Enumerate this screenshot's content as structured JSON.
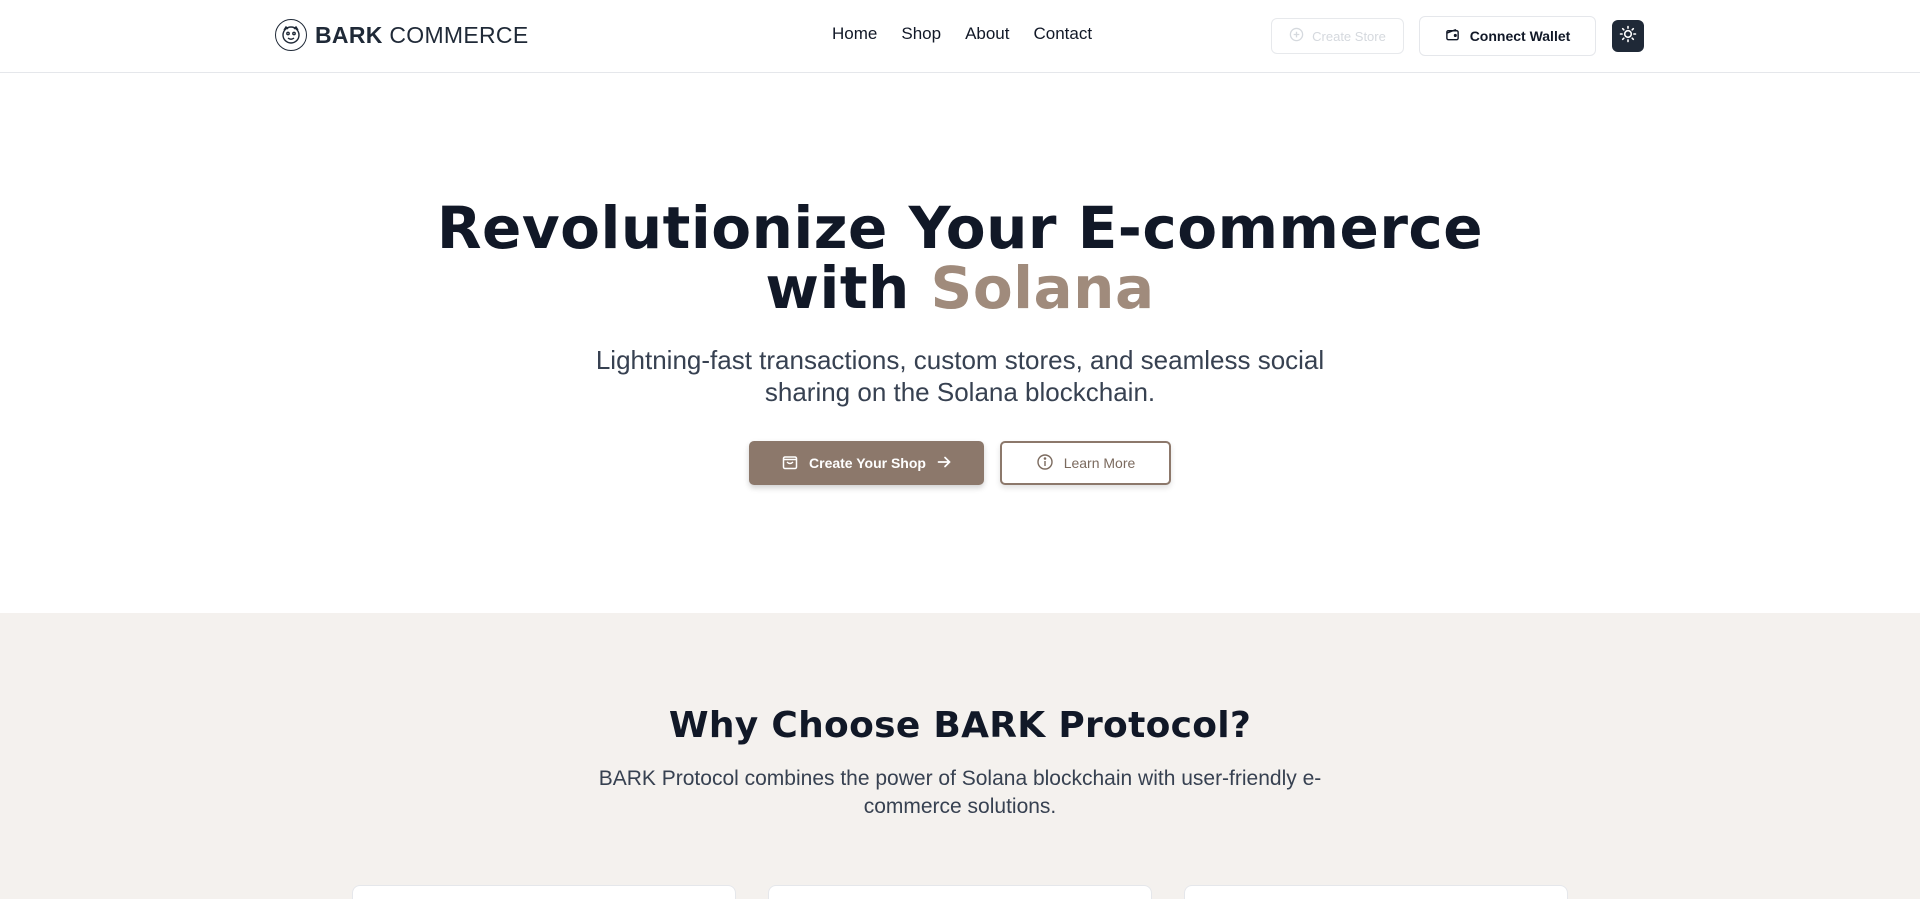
{
  "header": {
    "brand_bold": "BARK",
    "brand_rest": "COMMERCE",
    "nav": [
      "Home",
      "Shop",
      "About",
      "Contact"
    ],
    "create_store_label": "Create Store",
    "connect_wallet_label": "Connect Wallet"
  },
  "hero": {
    "title_line1": "Revolutionize Your E-commerce",
    "title_with": "with",
    "title_accent": "Solana",
    "subtitle": "Lightning-fast transactions, custom stores, and seamless social sharing on the Solana blockchain.",
    "primary_button": "Create Your Shop",
    "secondary_button": "Learn More"
  },
  "features": {
    "title": "Why Choose BARK Protocol?",
    "subtitle": "BARK Protocol combines the power of Solana blockchain with user-friendly e-commerce solutions."
  },
  "colors": {
    "accent": "#8c786b",
    "accent_text": "#a08b7c",
    "section_bg": "#f4f1ee",
    "dark": "#1f2937"
  },
  "icons": [
    "brand-logo-icon",
    "plus-circle-icon",
    "wallet-icon",
    "sun-icon",
    "shopping-bag-icon",
    "arrow-right-icon",
    "info-icon"
  ]
}
